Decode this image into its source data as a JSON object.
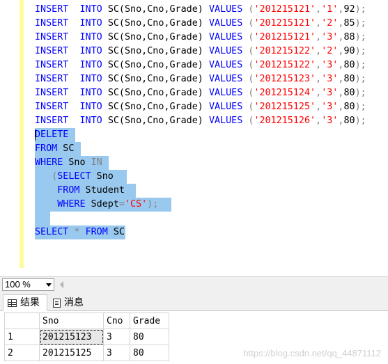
{
  "editor": {
    "insert_lines": [
      {
        "kw1": "INSERT",
        "kw2": "INTO",
        "tbl": "SC(Sno,Cno,Grade)",
        "kw3": "VALUES",
        "p1": "(",
        "sno": "'201215121'",
        "c1": ",",
        "cno": "'1'",
        "c2": ",",
        "grade": "92",
        "end": ");"
      },
      {
        "kw1": "INSERT",
        "kw2": "INTO",
        "tbl": "SC(Sno,Cno,Grade)",
        "kw3": "VALUES",
        "p1": "(",
        "sno": "'201215121'",
        "c1": ",",
        "cno": "'2'",
        "c2": ",",
        "grade": "85",
        "end": ");"
      },
      {
        "kw1": "INSERT",
        "kw2": "INTO",
        "tbl": "SC(Sno,Cno,Grade)",
        "kw3": "VALUES",
        "p1": "(",
        "sno": "'201215121'",
        "c1": ",",
        "cno": "'3'",
        "c2": ",",
        "grade": "88",
        "end": ");"
      },
      {
        "kw1": "INSERT",
        "kw2": "INTO",
        "tbl": "SC(Sno,Cno,Grade)",
        "kw3": "VALUES",
        "p1": "(",
        "sno": "'201215122'",
        "c1": ",",
        "cno": "'2'",
        "c2": ",",
        "grade": "90",
        "end": ");"
      },
      {
        "kw1": "INSERT",
        "kw2": "INTO",
        "tbl": "SC(Sno,Cno,Grade)",
        "kw3": "VALUES",
        "p1": "(",
        "sno": "'201215122'",
        "c1": ",",
        "cno": "'3'",
        "c2": ",",
        "grade": "80",
        "end": ");"
      },
      {
        "kw1": "INSERT",
        "kw2": "INTO",
        "tbl": "SC(Sno,Cno,Grade)",
        "kw3": "VALUES",
        "p1": "(",
        "sno": "'201215123'",
        "c1": ",",
        "cno": "'3'",
        "c2": ",",
        "grade": "80",
        "end": ");"
      },
      {
        "kw1": "INSERT",
        "kw2": "INTO",
        "tbl": "SC(Sno,Cno,Grade)",
        "kw3": "VALUES",
        "p1": "(",
        "sno": "'201215124'",
        "c1": ",",
        "cno": "'3'",
        "c2": ",",
        "grade": "80",
        "end": ");"
      },
      {
        "kw1": "INSERT",
        "kw2": "INTO",
        "tbl": "SC(Sno,Cno,Grade)",
        "kw3": "VALUES",
        "p1": "(",
        "sno": "'201215125'",
        "c1": ",",
        "cno": "'3'",
        "c2": ",",
        "grade": "80",
        "end": ");"
      },
      {
        "kw1": "INSERT",
        "kw2": "INTO",
        "tbl": "SC(Sno,Cno,Grade)",
        "kw3": "VALUES",
        "p1": "(",
        "sno": "'201215126'",
        "c1": ",",
        "cno": "'3'",
        "c2": ",",
        "grade": "80",
        "end": ");"
      }
    ],
    "delete_stmt": {
      "l1": "DELETE",
      "l2_kw": "FROM",
      "l2_tbl": " SC",
      "l3_kw": "WHERE",
      "l3_col": " Sno ",
      "l3_in": "IN",
      "l4_paren": "(",
      "l4_kw": "SELECT",
      "l4_col": " Sno",
      "l5_kw": "FROM",
      "l5_tbl": " Student",
      "l6_kw": "WHERE",
      "l6_col": " Sdept",
      "l6_eq": "=",
      "l6_str": "'CS'",
      "l6_end": ");"
    },
    "select_stmt": {
      "kw1": "SELECT",
      "star": " * ",
      "kw2": "FROM",
      "tbl": " SC"
    }
  },
  "zoom": {
    "value": "100 %"
  },
  "tabs": {
    "results": "结果",
    "messages": "消息"
  },
  "results": {
    "columns": [
      "Sno",
      "Cno",
      "Grade"
    ],
    "rows": [
      {
        "num": "1",
        "sno": "201215123",
        "cno": "3",
        "grade": "80"
      },
      {
        "num": "2",
        "sno": "201215125",
        "cno": "3",
        "grade": "80"
      }
    ]
  },
  "watermark": "https://blog.csdn.net/qq_44871112",
  "colors": {
    "keyword": "#0000ff",
    "string": "#ff0000",
    "operator": "#808080",
    "selection": "#99c9ef"
  }
}
